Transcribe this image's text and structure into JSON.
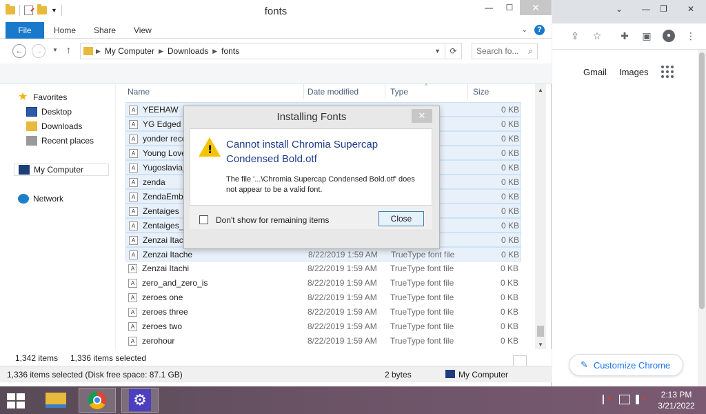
{
  "explorer": {
    "title": "fonts",
    "ribbon_tabs": [
      "File",
      "Home",
      "Share",
      "View"
    ],
    "address": {
      "crumbs": [
        "My Computer",
        "Downloads",
        "fonts"
      ]
    },
    "search_placeholder": "Search fo...",
    "nav": {
      "favorites": "Favorites",
      "desktop": "Desktop",
      "downloads": "Downloads",
      "recent": "Recent places",
      "computer": "My Computer",
      "network": "Network"
    },
    "columns": {
      "name": "Name",
      "date": "Date modified",
      "type": "Type",
      "size": "Size"
    },
    "rows": [
      {
        "name": "YEEHAW",
        "date": "",
        "type": "nt file",
        "size": "0 KB"
      },
      {
        "name": "YG Edged",
        "date": "",
        "type": "nt file",
        "size": "0 KB"
      },
      {
        "name": "yonder reco",
        "date": "",
        "type": "nt file",
        "size": "0 KB"
      },
      {
        "name": "Young Love",
        "date": "",
        "type": "nt file",
        "size": "0 KB"
      },
      {
        "name": "Yugoslavia_",
        "date": "",
        "type": "nt file",
        "size": "0 KB"
      },
      {
        "name": "zenda",
        "date": "",
        "type": "nt file",
        "size": "0 KB"
      },
      {
        "name": "ZendaEmbo",
        "date": "",
        "type": "nt file",
        "size": "0 KB"
      },
      {
        "name": "Zentaiges",
        "date": "",
        "type": "nt file",
        "size": "0 KB"
      },
      {
        "name": "Zentaiges_1",
        "date": "",
        "type": "nt file",
        "size": "0 KB"
      },
      {
        "name": "Zenzai Itacha",
        "date": "",
        "type": "nt file",
        "size": "0 KB"
      },
      {
        "name": "Zenzai Itache",
        "date": "8/22/2019 1:59 AM",
        "type": "TrueType font file",
        "size": "0 KB"
      },
      {
        "name": "Zenzai Itachi",
        "date": "8/22/2019 1:59 AM",
        "type": "TrueType font file",
        "size": "0 KB"
      },
      {
        "name": "zero_and_zero_is",
        "date": "8/22/2019 1:59 AM",
        "type": "TrueType font file",
        "size": "0 KB"
      },
      {
        "name": "zeroes one",
        "date": "8/22/2019 1:59 AM",
        "type": "TrueType font file",
        "size": "0 KB"
      },
      {
        "name": "zeroes three",
        "date": "8/22/2019 1:59 AM",
        "type": "TrueType font file",
        "size": "0 KB"
      },
      {
        "name": "zeroes two",
        "date": "8/22/2019 1:59 AM",
        "type": "TrueType font file",
        "size": "0 KB"
      },
      {
        "name": "zerohour",
        "date": "8/22/2019 1:59 AM",
        "type": "TrueType font file",
        "size": "0 KB"
      }
    ],
    "status": {
      "items": "1,342 items",
      "selected": "1,336 items selected"
    },
    "details": {
      "summary": "1,336 items selected (Disk free space: 87.1 GB)",
      "size": "2 bytes",
      "location": "My Computer"
    }
  },
  "dialog": {
    "title": "Installing Fonts",
    "heading": "Cannot install Chromia Supercap Condensed Bold.otf",
    "message": "The file '...\\Chromia Supercap Condensed Bold.otf' does not appear to be a valid font.",
    "checkbox_label": "Don't show for remaining items",
    "close_label": "Close"
  },
  "chrome": {
    "links": [
      "Gmail",
      "Images"
    ],
    "customize_label": "Customize Chrome"
  },
  "taskbar": {
    "time": "2:13 PM",
    "date": "3/21/2022"
  },
  "colors": {
    "accent": "#1979ca",
    "dialog_heading": "#1c3c8c",
    "chrome_blue": "#1a73e8"
  }
}
